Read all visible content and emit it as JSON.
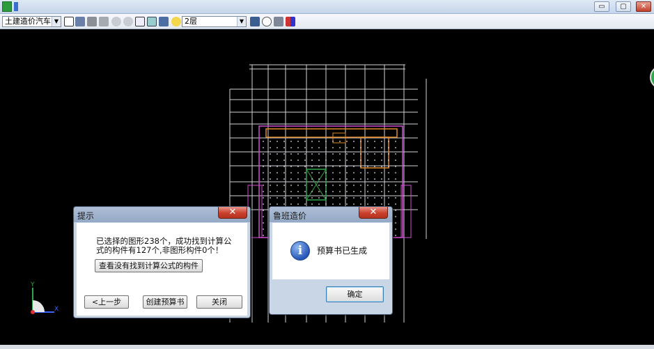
{
  "window": {
    "title": "",
    "minimize_glyph": "▭",
    "maximize_glyph": "▢",
    "close_glyph": "✕"
  },
  "toolbar": {
    "profession_combo": "土建造价汽车",
    "floor_combo": "2层",
    "combo_arrow": "▼"
  },
  "canvas": {
    "background": "#000000",
    "axis_x_label": "X",
    "axis_y_label": "Y"
  },
  "prompt_dialog": {
    "title": "提示",
    "close_glyph": "✕",
    "message_line1": "已选择的图形238个，成功找到计算公",
    "message_line2": "式的构件有127个,非图形构件0个！",
    "find_missing_button": "查看没有找到计算公式的构件",
    "prev_button": "<上一步",
    "create_button": "创建预算书",
    "close_button": "关闭"
  },
  "luban_dialog": {
    "title": "鲁班造价",
    "close_glyph": "✕",
    "icon": "info-icon",
    "message": "预算书已生成",
    "ok_button": "确定"
  },
  "colors": {
    "grid": "#cfd3d8",
    "magenta": "#d24cd2",
    "orange": "#e08a2a",
    "green": "#2ea84a",
    "dots": "#f0e0f0"
  }
}
